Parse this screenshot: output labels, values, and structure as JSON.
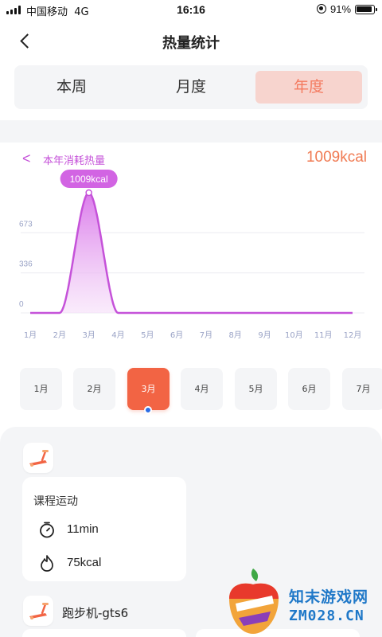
{
  "status_bar": {
    "carrier": "中国移动",
    "network": "4G",
    "time": "16:16",
    "battery": "91%"
  },
  "nav": {
    "title": "热量统计"
  },
  "tabs": [
    {
      "label": "本周",
      "active": false
    },
    {
      "label": "月度",
      "active": false
    },
    {
      "label": "年度",
      "active": true
    }
  ],
  "chart_header": {
    "label": "本年消耗热量",
    "total": "1009kcal"
  },
  "chart_data": {
    "type": "area",
    "x": [
      "1月",
      "2月",
      "3月",
      "4月",
      "5月",
      "6月",
      "7月",
      "8月",
      "9月",
      "10月",
      "11月",
      "12月"
    ],
    "series": [
      {
        "values": [
          0,
          0,
          1009,
          0,
          0,
          0,
          0,
          0,
          0,
          0,
          0,
          0
        ]
      }
    ],
    "y_ticks": [
      "673",
      "336",
      "0"
    ],
    "ylim": [
      0,
      1009
    ],
    "tooltip": "1009kcal",
    "grid": true,
    "colors": {
      "line": "#c552d9",
      "fill": "#e9a6f2",
      "tooltip_bg": "#d264e3"
    }
  },
  "months": [
    {
      "label": "1月",
      "active": false
    },
    {
      "label": "2月",
      "active": false
    },
    {
      "label": "3月",
      "active": true
    },
    {
      "label": "4月",
      "active": false
    },
    {
      "label": "5月",
      "active": false
    },
    {
      "label": "6月",
      "active": false
    },
    {
      "label": "7月",
      "active": false
    }
  ],
  "records": {
    "course": {
      "title": "课程运动",
      "duration": "11min",
      "calories": "75kcal"
    },
    "device": {
      "name": "跑步机-gts6"
    }
  },
  "watermark": {
    "cn": "知末游戏网",
    "en": "ZM028.CN"
  },
  "colors": {
    "accent": "#f26444",
    "chart_purple": "#c552d9",
    "tab_active_bg": "#f7d4ce",
    "tab_active_text": "#f47a5f",
    "panel_bg": "#f4f5f7"
  }
}
